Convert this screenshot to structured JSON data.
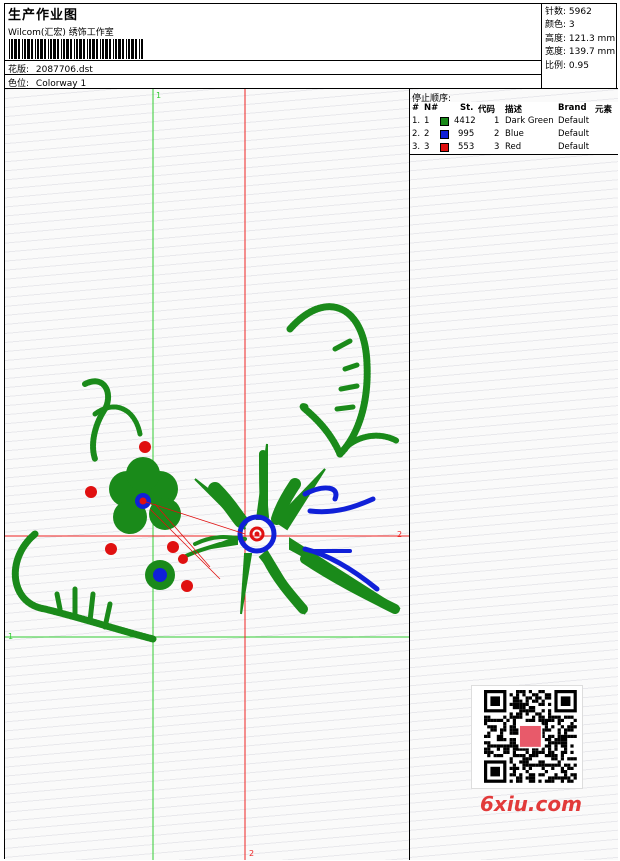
{
  "header": {
    "title": "生产作业图",
    "studio": "Wilcom(汇宏) 绣饰工作室",
    "design_label": "花版:",
    "design_file": "2087706.dst",
    "colorway_label": "色位:",
    "colorway": "Colorway 1"
  },
  "stats": [
    {
      "label": "针数",
      "value": "5962"
    },
    {
      "label": "颜色",
      "value": "3"
    },
    {
      "label": "高度",
      "value": "121.3 mm"
    },
    {
      "label": "宽度",
      "value": "139.7 mm"
    },
    {
      "label": "比例",
      "value": "0.95"
    }
  ],
  "stop_sequence": {
    "title": "停止顺序:",
    "columns": [
      "#",
      "N#",
      "St.",
      "代码",
      "描述",
      "Brand",
      "元素"
    ],
    "rows": [
      {
        "index": "1.",
        "n": "1",
        "stitches": "4412",
        "code": "1",
        "desc": "Dark Green",
        "brand": "Default",
        "color": "#1a8a1a"
      },
      {
        "index": "2.",
        "n": "2",
        "stitches": "995",
        "code": "2",
        "desc": "Blue",
        "brand": "Default",
        "color": "#1020d8"
      },
      {
        "index": "3.",
        "n": "3",
        "stitches": "553",
        "code": "3",
        "desc": "Red",
        "brand": "Default",
        "color": "#e01010"
      }
    ]
  },
  "guides": {
    "v1_label": "1",
    "h1_label": "1",
    "h2_label": "2",
    "v2_label": "2"
  },
  "watermark": {
    "site": "6xiu.com"
  },
  "colors": {
    "green": "#1a8a1a",
    "blue": "#1020d8",
    "red": "#e01010",
    "guide_green": "#33cc33",
    "guide_red": "#ee2222"
  }
}
